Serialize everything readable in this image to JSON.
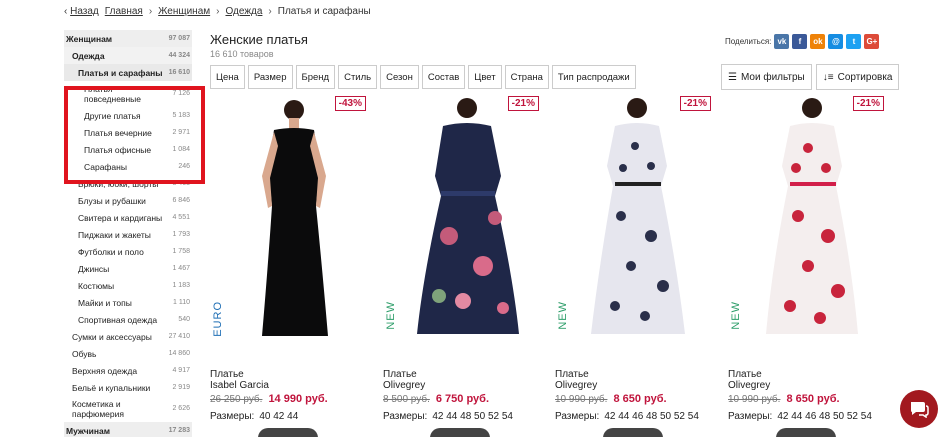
{
  "breadcrumb": {
    "back": "Назад",
    "items": [
      "Главная",
      "Женщинам",
      "Одежда"
    ],
    "current": "Платья и сарафаны"
  },
  "sidebar": {
    "items": [
      {
        "label": "Женщинам",
        "count": "97 087"
      },
      {
        "label": "Одежда",
        "count": "44 324"
      },
      {
        "label": "Платья и сарафаны",
        "count": "16 610"
      },
      {
        "label": "Платья повседневные",
        "count": "7 126"
      },
      {
        "label": "Другие платья",
        "count": "5 183"
      },
      {
        "label": "Платья вечерние",
        "count": "2 971"
      },
      {
        "label": "Платья офисные",
        "count": "1 084"
      },
      {
        "label": "Сарафаны",
        "count": "246"
      },
      {
        "label": "Брюки, юбки, шорты",
        "count": "8 463"
      },
      {
        "label": "Блузы и рубашки",
        "count": "6 846"
      },
      {
        "label": "Свитера и кардиганы",
        "count": "4 551"
      },
      {
        "label": "Пиджаки и жакеты",
        "count": "1 793"
      },
      {
        "label": "Футболки и поло",
        "count": "1 758"
      },
      {
        "label": "Джинсы",
        "count": "1 467"
      },
      {
        "label": "Костюмы",
        "count": "1 183"
      },
      {
        "label": "Майки и топы",
        "count": "1 110"
      },
      {
        "label": "Спортивная одежда",
        "count": "540"
      },
      {
        "label": "Сумки и аксессуары",
        "count": "27 410"
      },
      {
        "label": "Обувь",
        "count": "14 860"
      },
      {
        "label": "Верхняя одежда",
        "count": "4 917"
      },
      {
        "label": "Бельё и купальники",
        "count": "2 919"
      },
      {
        "label": "Косметика и парфюмерия",
        "count": "2 626"
      },
      {
        "label": "Мужчинам",
        "count": "17 283"
      }
    ]
  },
  "heading": {
    "title": "Женские платья",
    "count": "16 610 товаров"
  },
  "share": {
    "label": "Поделиться:"
  },
  "filters": [
    "Цена",
    "Размер",
    "Бренд",
    "Стиль",
    "Сезон",
    "Состав",
    "Цвет",
    "Страна",
    "Тип распродажи"
  ],
  "right_buttons": {
    "filters": "Мои фильтры",
    "sort": "Сортировка"
  },
  "products": [
    {
      "discount": "-43%",
      "tag": "EURO",
      "type": "Платье",
      "brand": "Isabel Garcia",
      "old_price": "26 250 руб.",
      "price": "14 990 руб.",
      "sizes_label": "Размеры:",
      "sizes": "40 42 44"
    },
    {
      "discount": "-21%",
      "tag": "NEW",
      "type": "Платье",
      "brand": "Olivegrey",
      "old_price": "8 500 руб.",
      "price": "6 750 руб.",
      "sizes_label": "Размеры:",
      "sizes": "42 44 48 50 52 54"
    },
    {
      "discount": "-21%",
      "tag": "NEW",
      "type": "Платье",
      "brand": "Olivegrey",
      "old_price": "10 990 руб.",
      "price": "8 650 руб.",
      "sizes_label": "Размеры:",
      "sizes": "42 44 46 48 50 52 54"
    },
    {
      "discount": "-21%",
      "tag": "NEW",
      "type": "Платье",
      "brand": "Olivegrey",
      "old_price": "10 990 руб.",
      "price": "8 650 руб.",
      "sizes_label": "Размеры:",
      "sizes": "42 44 46 48 50 52 54"
    }
  ],
  "colors": {
    "accent": "#c0143c",
    "highlight": "#e0141e",
    "euro": "#1f6fb5",
    "new": "#2e9e6a"
  }
}
